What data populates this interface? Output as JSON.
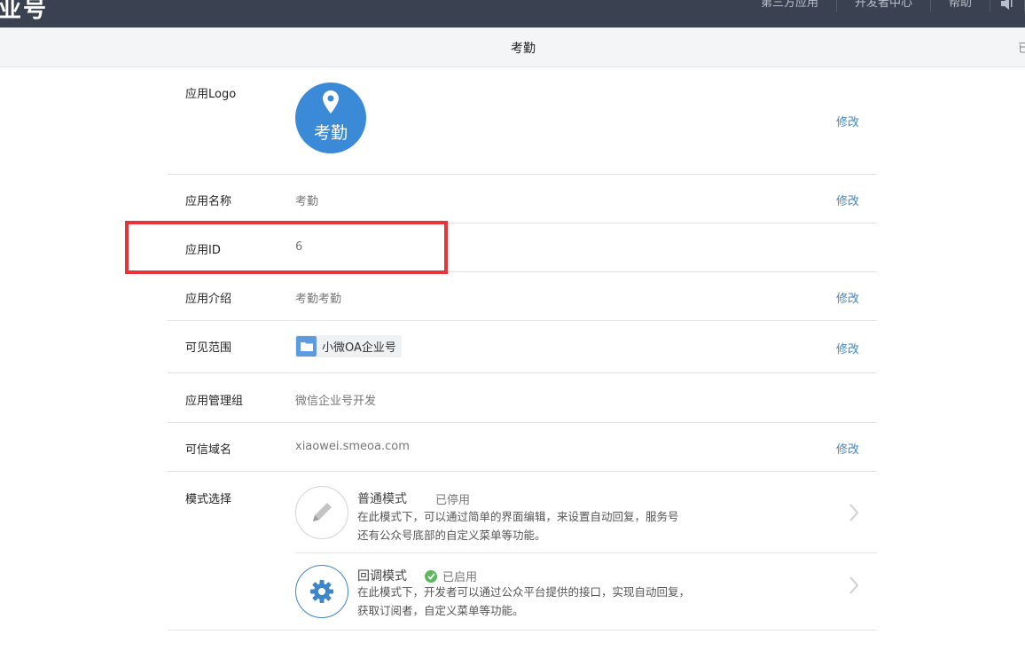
{
  "topbar": {
    "brand_text": "业号",
    "nav": [
      "第三方应用",
      "开发者中心",
      "帮助"
    ],
    "speaker_icon": "speaker-icon"
  },
  "subheader": {
    "title": "考勤",
    "edge_text": "已"
  },
  "rows": {
    "logo": {
      "label": "应用Logo",
      "logo_text": "考勤",
      "logo_icon": "location-pin-icon",
      "logo_color": "#3a8ad8",
      "edit": "修改"
    },
    "name": {
      "label": "应用名称",
      "value": "考勤",
      "edit": "修改"
    },
    "id": {
      "label": "应用ID",
      "value": "6"
    },
    "intro": {
      "label": "应用介绍",
      "value": "考勤考勤",
      "edit": "修改"
    },
    "scope": {
      "label": "可见范围",
      "tag_text": "小微OA企业号",
      "tag_icon": "folder-icon",
      "edit": "修改"
    },
    "group": {
      "label": "应用管理组",
      "value": "微信企业号开发"
    },
    "domain": {
      "label": "可信域名",
      "value": "xiaowei.smeoa.com",
      "edit": "修改"
    },
    "mode": {
      "label": "模式选择",
      "normal": {
        "title": "普通模式",
        "status": "已停用",
        "desc_line1": "在此模式下，可以通过简单的界面编辑，来设置自动回复，服务号",
        "desc_line2": "还有公众号底部的自定义菜单等功能。",
        "icon": "pencil-icon"
      },
      "callback": {
        "title": "回调模式",
        "status": "已启用",
        "status_icon": "check-circle-icon",
        "desc_line1": "在此模式下，开发者可以通过公众平台提供的接口，实现自动回复，",
        "desc_line2": "获取订阅者，自定义菜单等功能。",
        "icon": "gear-icon"
      }
    }
  },
  "colors": {
    "topbar_bg": "#3a4252",
    "link": "#3f86c8",
    "highlight_border": "#e8333a",
    "enabled_green": "#5cb85c"
  }
}
